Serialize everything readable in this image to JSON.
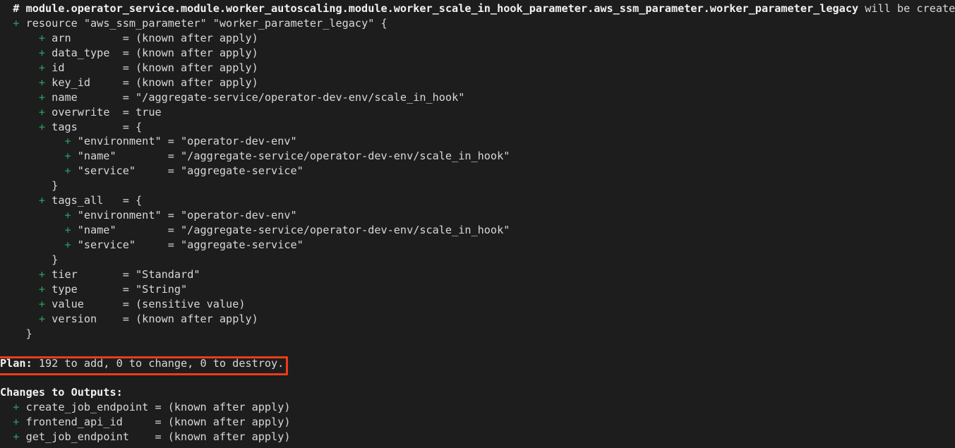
{
  "terminal": {
    "app": "terraform-plan-output",
    "background_color": "#1d1d1d",
    "text_color": "#d8d8d8",
    "add_marker_color": "#27a35f",
    "highlight_border_color": "#ee3b18"
  },
  "resource_header": {
    "comment_marker": "  # ",
    "address": "module.operator_service.module.worker_autoscaling.module.worker_scale_in_hook_parameter.aws_ssm_parameter.worker_parameter_legacy",
    "action_text": " will be created"
  },
  "resource_declaration": {
    "indent": "  ",
    "plus": "+",
    "text": " resource \"aws_ssm_parameter\" \"worker_parameter_legacy\" {"
  },
  "attributes": [
    {
      "indent": "      ",
      "plus": "+",
      "text": " arn        = (known after apply)"
    },
    {
      "indent": "      ",
      "plus": "+",
      "text": " data_type  = (known after apply)"
    },
    {
      "indent": "      ",
      "plus": "+",
      "text": " id         = (known after apply)"
    },
    {
      "indent": "      ",
      "plus": "+",
      "text": " key_id     = (known after apply)"
    },
    {
      "indent": "      ",
      "plus": "+",
      "text": " name       = \"/aggregate-service/operator-dev-env/scale_in_hook\""
    },
    {
      "indent": "      ",
      "plus": "+",
      "text": " overwrite  = true"
    },
    {
      "indent": "      ",
      "plus": "+",
      "text": " tags       = {"
    },
    {
      "indent": "          ",
      "plus": "+",
      "text": " \"environment\" = \"operator-dev-env\""
    },
    {
      "indent": "          ",
      "plus": "+",
      "text": " \"name\"        = \"/aggregate-service/operator-dev-env/scale_in_hook\""
    },
    {
      "indent": "          ",
      "plus": "+",
      "text": " \"service\"     = \"aggregate-service\""
    },
    {
      "indent": "        ",
      "plus": "",
      "text": "}"
    },
    {
      "indent": "      ",
      "plus": "+",
      "text": " tags_all   = {"
    },
    {
      "indent": "          ",
      "plus": "+",
      "text": " \"environment\" = \"operator-dev-env\""
    },
    {
      "indent": "          ",
      "plus": "+",
      "text": " \"name\"        = \"/aggregate-service/operator-dev-env/scale_in_hook\""
    },
    {
      "indent": "          ",
      "plus": "+",
      "text": " \"service\"     = \"aggregate-service\""
    },
    {
      "indent": "        ",
      "plus": "",
      "text": "}"
    },
    {
      "indent": "      ",
      "plus": "+",
      "text": " tier       = \"Standard\""
    },
    {
      "indent": "      ",
      "plus": "+",
      "text": " type       = \"String\""
    },
    {
      "indent": "      ",
      "plus": "+",
      "text": " value      = (sensitive value)"
    },
    {
      "indent": "      ",
      "plus": "+",
      "text": " version    = (known after apply)"
    },
    {
      "indent": "    ",
      "plus": "",
      "text": "}"
    }
  ],
  "plan_summary": {
    "label": "Plan:",
    "detail": " 192 to add, 0 to change, 0 to destroy.",
    "add_count": "192",
    "change_count": "0",
    "destroy_count": "0"
  },
  "outputs_section": {
    "heading": "Changes to Outputs:",
    "entries": [
      {
        "indent": "  ",
        "plus": "+",
        "text": " create_job_endpoint = (known after apply)"
      },
      {
        "indent": "  ",
        "plus": "+",
        "text": " frontend_api_id     = (known after apply)"
      },
      {
        "indent": "  ",
        "plus": "+",
        "text": " get_job_endpoint    = (known after apply)"
      }
    ]
  }
}
